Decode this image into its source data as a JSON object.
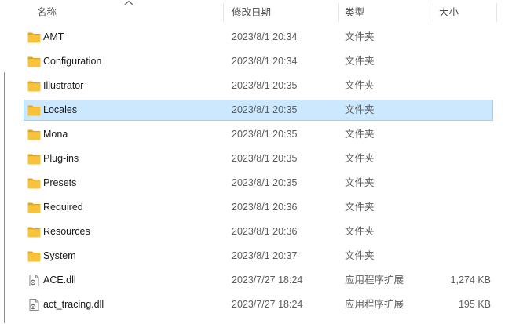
{
  "columns": {
    "name": "名称",
    "date": "修改日期",
    "type": "类型",
    "size": "大小"
  },
  "rows": [
    {
      "name": "AMT",
      "date": "2023/8/1 20:34",
      "type": "文件夹",
      "size": "",
      "icon": "folder-icon",
      "selected": false
    },
    {
      "name": "Configuration",
      "date": "2023/8/1 20:34",
      "type": "文件夹",
      "size": "",
      "icon": "folder-icon",
      "selected": false
    },
    {
      "name": "Illustrator",
      "date": "2023/8/1 20:35",
      "type": "文件夹",
      "size": "",
      "icon": "folder-icon",
      "selected": false
    },
    {
      "name": "Locales",
      "date": "2023/8/1 20:35",
      "type": "文件夹",
      "size": "",
      "icon": "folder-icon",
      "selected": true
    },
    {
      "name": "Mona",
      "date": "2023/8/1 20:35",
      "type": "文件夹",
      "size": "",
      "icon": "folder-icon",
      "selected": false
    },
    {
      "name": "Plug-ins",
      "date": "2023/8/1 20:35",
      "type": "文件夹",
      "size": "",
      "icon": "folder-icon",
      "selected": false
    },
    {
      "name": "Presets",
      "date": "2023/8/1 20:35",
      "type": "文件夹",
      "size": "",
      "icon": "folder-icon",
      "selected": false
    },
    {
      "name": "Required",
      "date": "2023/8/1 20:36",
      "type": "文件夹",
      "size": "",
      "icon": "folder-icon",
      "selected": false
    },
    {
      "name": "Resources",
      "date": "2023/8/1 20:36",
      "type": "文件夹",
      "size": "",
      "icon": "folder-icon",
      "selected": false
    },
    {
      "name": "System",
      "date": "2023/8/1 20:37",
      "type": "文件夹",
      "size": "",
      "icon": "folder-icon",
      "selected": false
    },
    {
      "name": "ACE.dll",
      "date": "2023/7/27 18:24",
      "type": "应用程序扩展",
      "size": "1,274 KB",
      "icon": "dll-file-icon",
      "selected": false
    },
    {
      "name": "act_tracing.dll",
      "date": "2023/7/27 18:24",
      "type": "应用程序扩展",
      "size": "195 KB",
      "icon": "dll-file-icon",
      "selected": false
    }
  ],
  "colors": {
    "folder": "#f8c33a",
    "folder_dark": "#e0a623",
    "selection_bg": "#cce8ff",
    "selection_border": "#99d1ff"
  }
}
